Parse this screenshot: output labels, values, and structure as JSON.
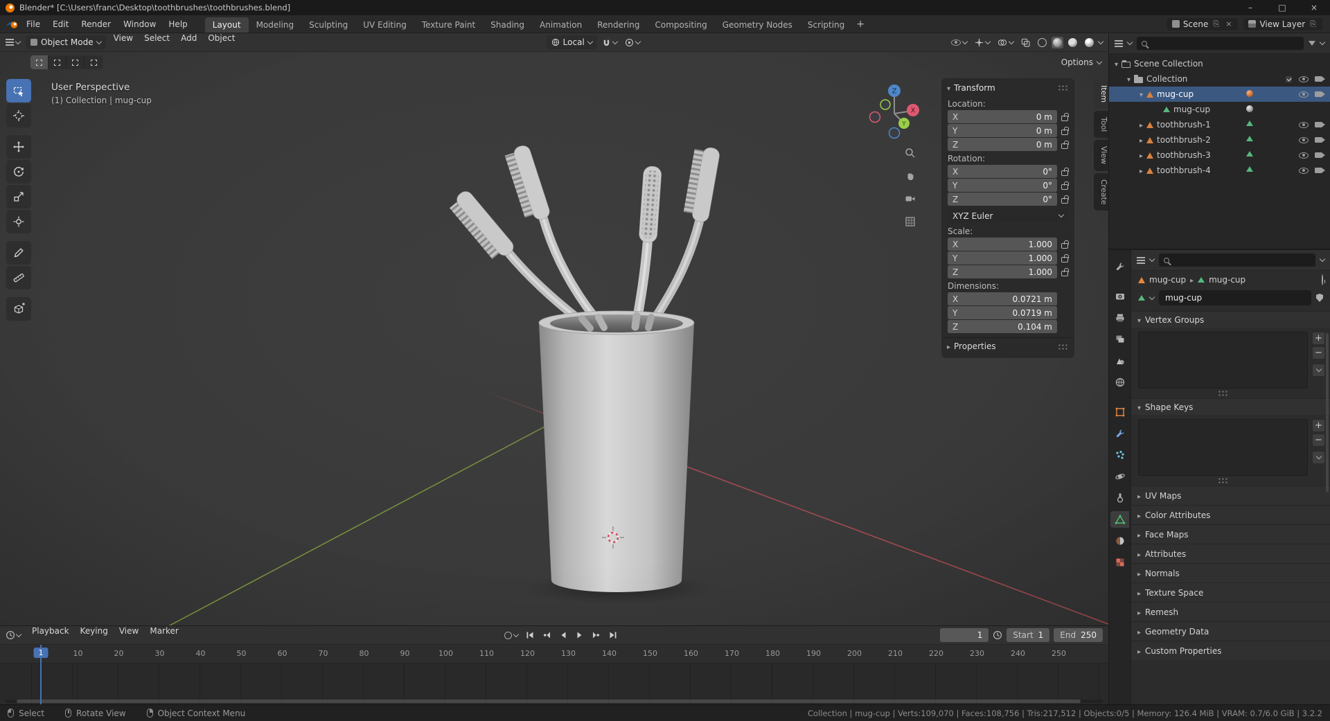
{
  "titlebar": {
    "title": "Blender* [C:\\Users\\franc\\Desktop\\toothbrushes\\toothbrushes.blend]",
    "controls": {
      "minimize": "–",
      "maximize": "□",
      "close": "×"
    }
  },
  "topbar": {
    "menus": [
      {
        "label": "File"
      },
      {
        "label": "Edit"
      },
      {
        "label": "Render"
      },
      {
        "label": "Window"
      },
      {
        "label": "Help"
      }
    ],
    "tabs": [
      {
        "label": "Layout",
        "active": true
      },
      {
        "label": "Modeling"
      },
      {
        "label": "Sculpting"
      },
      {
        "label": "UV Editing"
      },
      {
        "label": "Texture Paint"
      },
      {
        "label": "Shading"
      },
      {
        "label": "Animation"
      },
      {
        "label": "Rendering"
      },
      {
        "label": "Compositing"
      },
      {
        "label": "Geometry Nodes"
      },
      {
        "label": "Scripting"
      }
    ],
    "add_label": "+",
    "scene_label": "Scene",
    "view_layer_label": "View Layer"
  },
  "viewport": {
    "header": {
      "mode": "Object Mode",
      "menus": [
        {
          "label": "View"
        },
        {
          "label": "Select"
        },
        {
          "label": "Add"
        },
        {
          "label": "Object"
        }
      ],
      "orientation": "Local"
    },
    "tool_settings": {
      "options_label": "Options"
    },
    "overlay": {
      "line1": "User Perspective",
      "line2": "(1) Collection | mug-cup"
    },
    "axis_labels": {
      "x": "X",
      "y": "Y",
      "z": "Z"
    },
    "npanel": {
      "title": "Transform",
      "location": {
        "label": "Location:",
        "rows": [
          {
            "axis": "X",
            "value": "0 m"
          },
          {
            "axis": "Y",
            "value": "0 m"
          },
          {
            "axis": "Z",
            "value": "0 m"
          }
        ]
      },
      "rotation": {
        "label": "Rotation:",
        "rows": [
          {
            "axis": "X",
            "value": "0°"
          },
          {
            "axis": "Y",
            "value": "0°"
          },
          {
            "axis": "Z",
            "value": "0°"
          }
        ],
        "mode": "XYZ Euler"
      },
      "scale": {
        "label": "Scale:",
        "rows": [
          {
            "axis": "X",
            "value": "1.000"
          },
          {
            "axis": "Y",
            "value": "1.000"
          },
          {
            "axis": "Z",
            "value": "1.000"
          }
        ]
      },
      "dimensions": {
        "label": "Dimensions:",
        "rows": [
          {
            "axis": "X",
            "value": "0.0721 m"
          },
          {
            "axis": "Y",
            "value": "0.0719 m"
          },
          {
            "axis": "Z",
            "value": "0.104 m"
          }
        ]
      },
      "collapsed_label": "Properties",
      "tabs": [
        {
          "label": "Item",
          "active": true
        },
        {
          "label": "Tool"
        },
        {
          "label": "View"
        },
        {
          "label": "Create"
        }
      ]
    }
  },
  "outliner": {
    "rows": [
      {
        "name": "Scene Collection"
      },
      {
        "name": "Collection"
      },
      {
        "name": "mug-cup"
      },
      {
        "name": "mug-cup"
      },
      {
        "name": "toothbrush-1"
      },
      {
        "name": "toothbrush-2"
      },
      {
        "name": "toothbrush-3"
      },
      {
        "name": "toothbrush-4"
      }
    ]
  },
  "properties": {
    "breadcrumb": {
      "object": "mug-cup",
      "data": "mug-cup"
    },
    "name_value": "mug-cup",
    "expanded": [
      {
        "label": "Vertex Groups"
      },
      {
        "label": "Shape Keys"
      }
    ],
    "collapsed": [
      {
        "label": "UV Maps"
      },
      {
        "label": "Color Attributes"
      },
      {
        "label": "Face Maps"
      },
      {
        "label": "Attributes"
      },
      {
        "label": "Normals"
      },
      {
        "label": "Texture Space"
      },
      {
        "label": "Remesh"
      },
      {
        "label": "Geometry Data"
      },
      {
        "label": "Custom Properties"
      }
    ]
  },
  "timeline": {
    "menus": [
      {
        "label": "Playback"
      },
      {
        "label": "Keying"
      },
      {
        "label": "View"
      },
      {
        "label": "Marker"
      }
    ],
    "current_frame": "1",
    "start_label": "Start",
    "start_value": "1",
    "end_label": "End",
    "end_value": "250",
    "ruler": [
      10,
      20,
      30,
      40,
      50,
      60,
      70,
      80,
      90,
      100,
      110,
      120,
      130,
      140,
      150,
      160,
      170,
      180,
      190,
      200,
      210,
      220,
      230,
      240,
      250
    ],
    "playhead_label": "1"
  },
  "statusbar": {
    "hints": [
      {
        "label": "Select"
      },
      {
        "label": "Rotate View"
      },
      {
        "label": "Object Context Menu"
      }
    ],
    "stats": "Collection | mug-cup | Verts:109,070 | Faces:108,756 | Tris:217,512 | Objects:0/5 | Memory: 126.4 MiB | VRAM: 0.7/6.0 GiB | 3.2.2"
  }
}
